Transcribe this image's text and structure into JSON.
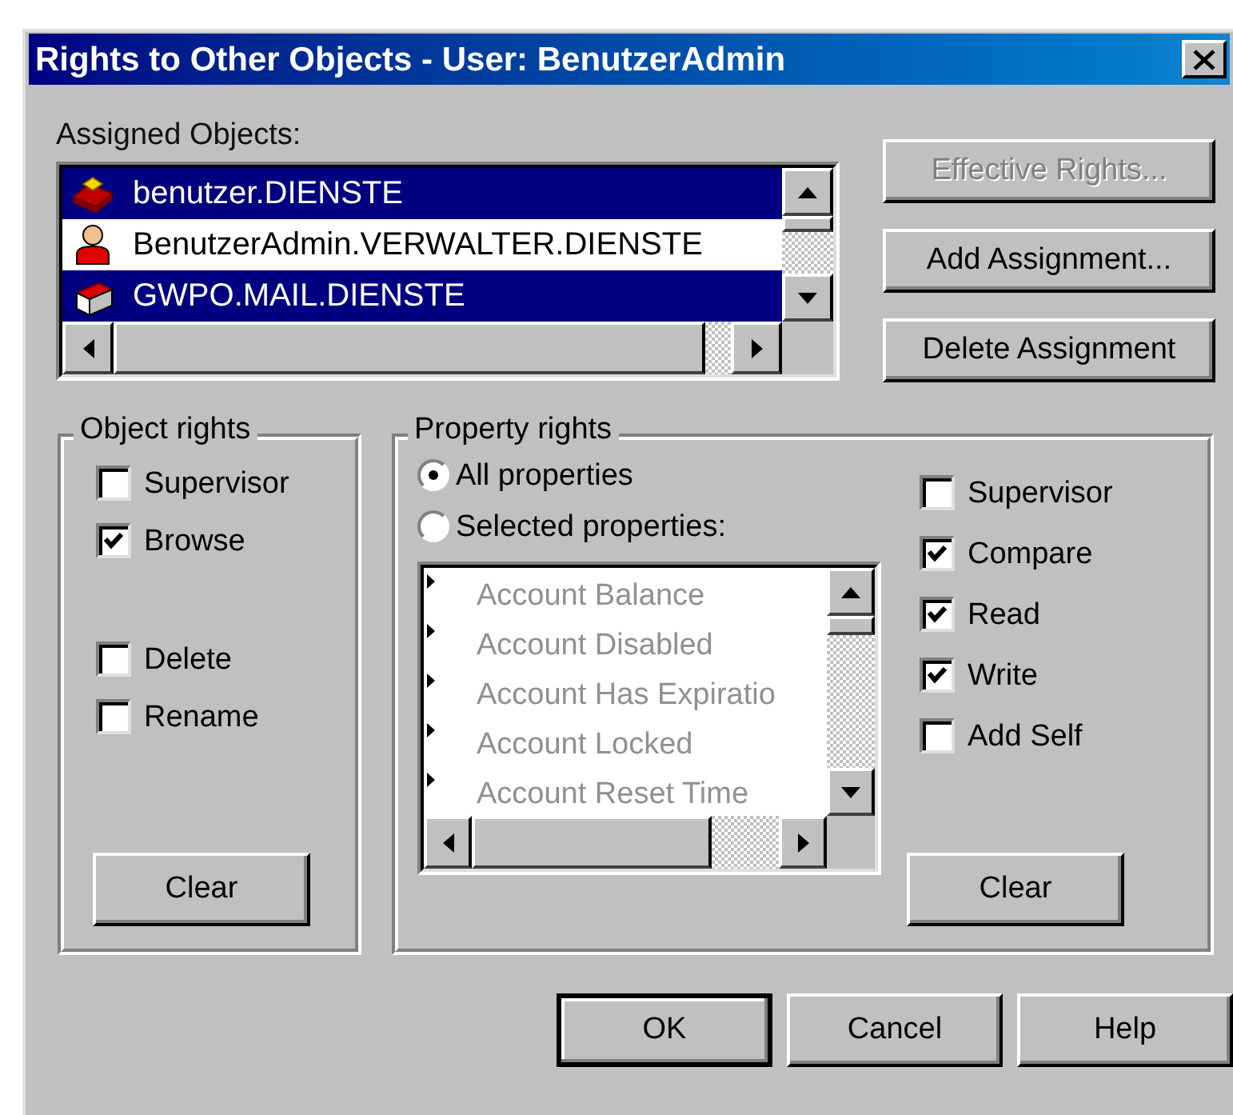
{
  "window": {
    "title": "Rights to Other Objects - User: BenutzerAdmin"
  },
  "assigned_objects": {
    "label": "Assigned Objects:",
    "items": [
      {
        "name": "benutzer.DIENSTE",
        "kind": "books",
        "selected": true
      },
      {
        "name": "BenutzerAdmin.VERWALTER.DIENSTE",
        "kind": "user",
        "selected": false
      },
      {
        "name": "GWPO.MAIL.DIENSTE",
        "kind": "mailbox",
        "selected": true
      }
    ]
  },
  "side_buttons": [
    {
      "label": "Effective Rights...",
      "disabled": true
    },
    {
      "label": "Add Assignment...",
      "disabled": false
    },
    {
      "label": "Delete Assignment",
      "disabled": false
    }
  ],
  "object_rights": {
    "title": "Object rights",
    "option_groups": [
      [
        {
          "label": "Supervisor",
          "checked": false
        },
        {
          "label": "Browse",
          "checked": true
        }
      ],
      [
        {
          "label": "Delete",
          "checked": false
        },
        {
          "label": "Rename",
          "checked": false
        }
      ]
    ],
    "clear": "Clear"
  },
  "property_rights": {
    "title": "Property rights",
    "scope": [
      {
        "label": "All properties",
        "selected": true
      },
      {
        "label": "Selected properties:",
        "selected": false
      }
    ],
    "properties": {
      "disabled": true,
      "items": [
        "Account Balance",
        "Account Disabled",
        "Account Has Expiratio",
        "Account Locked",
        "Account Reset Time"
      ]
    },
    "options": [
      {
        "label": "Supervisor",
        "checked": false
      },
      {
        "label": "Compare",
        "checked": true
      },
      {
        "label": "Read",
        "checked": true
      },
      {
        "label": "Write",
        "checked": true
      },
      {
        "label": "Add Self",
        "checked": false
      }
    ],
    "clear": "Clear"
  },
  "buttons": [
    {
      "label": "OK",
      "default": true
    },
    {
      "label": "Cancel",
      "default": false
    },
    {
      "label": "Help",
      "default": false
    }
  ]
}
